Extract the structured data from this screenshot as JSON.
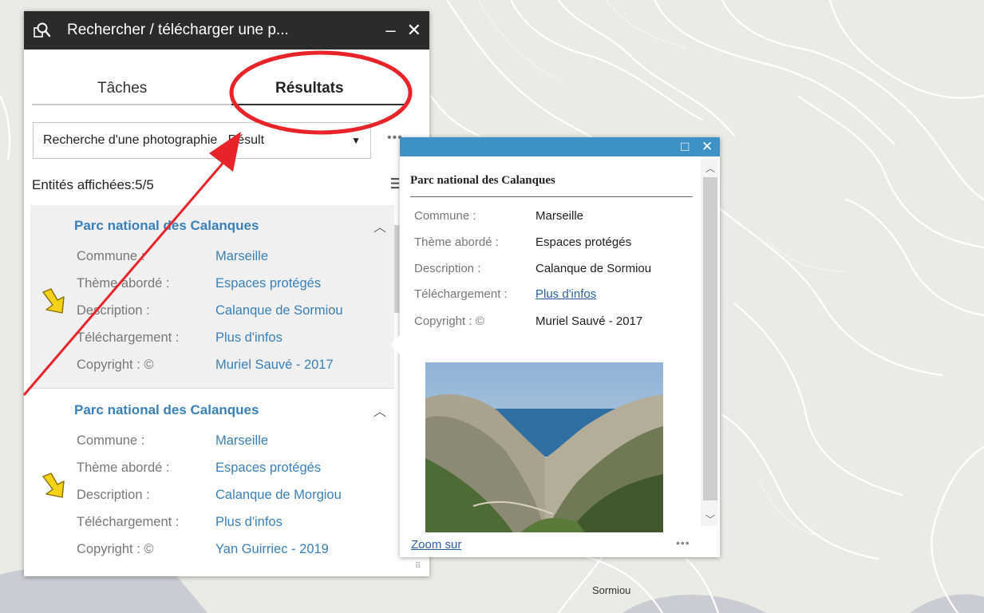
{
  "panel": {
    "title": "Rechercher / télécharger une p...",
    "minimize_label": "–",
    "close_label": "✕",
    "tabs": [
      {
        "label": "Tâches"
      },
      {
        "label": "Résultats"
      }
    ],
    "select_value": "Recherche d'une photographie _Résult",
    "more_label": "•••",
    "count_label": "Entités affichées:5/5",
    "results": [
      {
        "title": "Parc national des Calanques",
        "fields": [
          {
            "label": "Commune :",
            "value": "Marseille"
          },
          {
            "label": "Thème abordé :",
            "value": "Espaces protégés"
          },
          {
            "label": "Description :",
            "value": "Calanque de Sormiou"
          },
          {
            "label": "Téléchargement :",
            "value": "Plus d'infos"
          },
          {
            "label": "Copyright : ©",
            "value": "Muriel Sauvé - 2017"
          }
        ]
      },
      {
        "title": "Parc national des Calanques",
        "fields": [
          {
            "label": "Commune :",
            "value": "Marseille"
          },
          {
            "label": "Thème abordé :",
            "value": "Espaces protégés"
          },
          {
            "label": "Description :",
            "value": "Calanque de Morgiou"
          },
          {
            "label": "Téléchargement :",
            "value": "Plus d'infos"
          },
          {
            "label": "Copyright : ©",
            "value": "Yan Guirriec - 2019"
          }
        ]
      }
    ]
  },
  "popup": {
    "maximize_label": "□",
    "close_label": "✕",
    "title": "Parc national des Calanques",
    "fields": [
      {
        "label": "Commune :",
        "value": "Marseille"
      },
      {
        "label": "Thème abordé :",
        "value": "Espaces protégés"
      },
      {
        "label": "Description :",
        "value": "Calanque de Sormiou"
      },
      {
        "label": "Téléchargement :",
        "value": "Plus d'infos"
      },
      {
        "label": "Copyright : ©",
        "value": "Muriel Sauvé - 2017"
      }
    ],
    "zoom_label": "Zoom sur",
    "more_label": "•••"
  },
  "map": {
    "place_label": "Sormiou"
  },
  "colors": {
    "header_dark": "#2b2b2b",
    "popup_header": "#3e91c6",
    "link_blue": "#3a80b8",
    "annotation_red": "#e8232a",
    "map_bg": "#e9ebe4"
  }
}
